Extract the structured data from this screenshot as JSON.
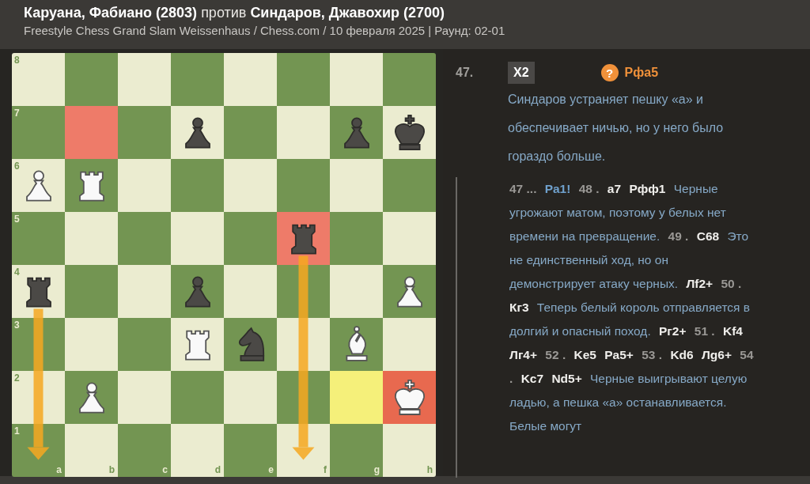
{
  "header": {
    "title": "**Каруана, Фабиано (2803)** против **Синдаров, Джавохир (2700)**",
    "subtitle": "Freestyle Chess Grand Slam Weissenhaus / Chess.com / 10 февраля 2025 | Раунд: 02-01"
  },
  "board": {
    "ranks": [
      "8",
      "7",
      "6",
      "5",
      "4",
      "3",
      "2",
      "1"
    ],
    "files": [
      "a",
      "b",
      "c",
      "d",
      "e",
      "f",
      "g",
      "h"
    ],
    "rows": [
      [
        {
          "kind": "empty"
        },
        {
          "kind": "empty"
        },
        {
          "kind": "empty"
        },
        {
          "kind": "empty"
        },
        {
          "kind": "empty"
        },
        {
          "kind": "empty"
        },
        {
          "kind": "empty"
        },
        {
          "kind": "empty"
        }
      ],
      [
        {
          "kind": "empty"
        },
        {
          "kind": "empty",
          "color": "#ee7b69"
        },
        {
          "kind": "empty"
        },
        {
          "kind": "pawn",
          "black": true
        },
        {
          "kind": "empty"
        },
        {
          "kind": "empty"
        },
        {
          "kind": "pawn",
          "black": true
        },
        {
          "kind": "king",
          "black": true
        }
      ],
      [
        {
          "kind": "pawn",
          "black": false
        },
        {
          "kind": "rook",
          "black": false
        },
        {
          "kind": "empty"
        },
        {
          "kind": "empty"
        },
        {
          "kind": "empty"
        },
        {
          "kind": "empty"
        },
        {
          "kind": "empty"
        },
        {
          "kind": "empty"
        }
      ],
      [
        {
          "kind": "empty"
        },
        {
          "kind": "empty"
        },
        {
          "kind": "empty"
        },
        {
          "kind": "empty"
        },
        {
          "kind": "empty"
        },
        {
          "kind": "rook",
          "black": true,
          "color": "#ee7b69",
          "arrow_start": true
        },
        {
          "kind": "empty"
        },
        {
          "kind": "empty"
        }
      ],
      [
        {
          "kind": "rook",
          "black": true,
          "arrow_start": true
        },
        {
          "kind": "empty"
        },
        {
          "kind": "empty"
        },
        {
          "kind": "pawn",
          "black": true
        },
        {
          "kind": "empty"
        },
        {
          "kind": "empty"
        },
        {
          "kind": "empty"
        },
        {
          "kind": "pawn",
          "black": false
        }
      ],
      [
        {
          "kind": "empty"
        },
        {
          "kind": "empty"
        },
        {
          "kind": "empty"
        },
        {
          "kind": "rook",
          "black": false
        },
        {
          "kind": "knight",
          "black": true
        },
        {
          "kind": "empty"
        },
        {
          "kind": "bishop",
          "black": false
        },
        {
          "kind": "empty"
        }
      ],
      [
        {
          "kind": "empty"
        },
        {
          "kind": "pawn",
          "black": false
        },
        {
          "kind": "empty"
        },
        {
          "kind": "empty"
        },
        {
          "kind": "empty"
        },
        {
          "kind": "empty"
        },
        {
          "kind": "empty",
          "color": "#f5f07a"
        },
        {
          "kind": "king",
          "black": false,
          "color": "#e8694f"
        }
      ],
      [
        {
          "kind": "empty",
          "arrow_end": true
        },
        {
          "kind": "empty"
        },
        {
          "kind": "empty"
        },
        {
          "kind": "empty"
        },
        {
          "kind": "empty"
        },
        {
          "kind": "empty",
          "arrow_end": true
        },
        {
          "kind": "empty"
        },
        {
          "kind": "empty"
        }
      ]
    ]
  },
  "move": {
    "number": "47.",
    "white_move": "X2",
    "mark": "?",
    "black_move": "Рфа5",
    "comment": "Синдаров устраняет пешку «а» и обеспечивает ничью, но у него было гораздо больше."
  },
  "variation": [
    {
      "kind": "num",
      "text": "47 ..."
    },
    {
      "kind": "alt",
      "text": "Ра1!"
    },
    {
      "kind": "num",
      "text": "48 ."
    },
    {
      "kind": "move",
      "text": "а7"
    },
    {
      "kind": "move",
      "text": "Рфф1"
    },
    {
      "kind": "comment",
      "text": "Черные угрожают матом, поэтому у белых нет времени на превращение."
    },
    {
      "kind": "num",
      "text": "49 ."
    },
    {
      "kind": "move",
      "text": "С68"
    },
    {
      "kind": "comment",
      "text": "Это не единственный ход, но он демонстрирует атаку черных."
    },
    {
      "kind": "move",
      "text": "Лf2+"
    },
    {
      "kind": "num",
      "text": "50 ."
    },
    {
      "kind": "move",
      "text": "Кг3"
    },
    {
      "kind": "comment",
      "text": "Теперь белый король отправляется в долгий и опасный поход."
    },
    {
      "kind": "move",
      "text": "Рг2+"
    },
    {
      "kind": "num",
      "text": "51 ."
    },
    {
      "kind": "move",
      "text": "Kf4"
    },
    {
      "kind": "move",
      "text": "Лг4+"
    },
    {
      "kind": "num",
      "text": "52 ."
    },
    {
      "kind": "move",
      "text": "Ke5"
    },
    {
      "kind": "move",
      "text": "Pa5+"
    },
    {
      "kind": "num",
      "text": "53 ."
    },
    {
      "kind": "move",
      "text": "Kd6"
    },
    {
      "kind": "move",
      "text": "Лg6+"
    },
    {
      "kind": "num",
      "text": "54 ."
    },
    {
      "kind": "move",
      "text": "Kc7"
    },
    {
      "kind": "move",
      "text": "Nd5+"
    },
    {
      "kind": "comment",
      "text": "Черные выигрывают целую ладью, а пешка «а» останавливается. Белые могут"
    }
  ]
}
